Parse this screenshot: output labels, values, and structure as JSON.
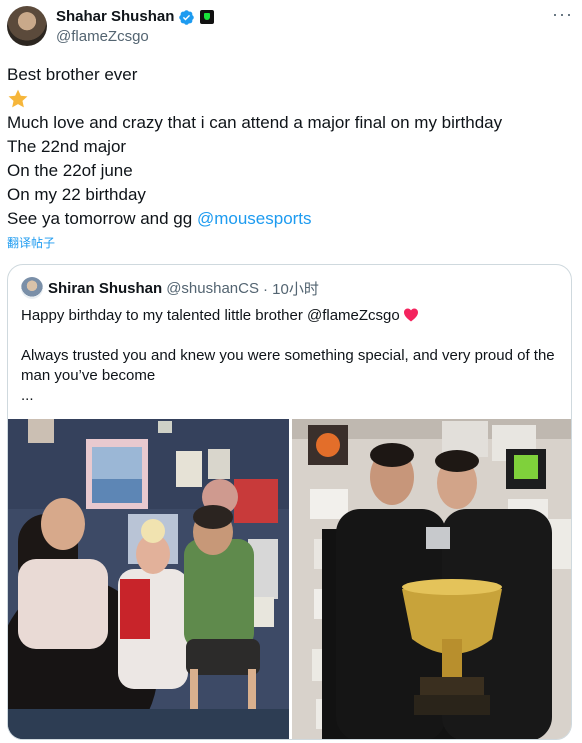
{
  "tweet": {
    "author_name": "Shahar Shushan",
    "author_handle": "@flameZcsgo",
    "more_label": "···",
    "lines": [
      "Best brother ever",
      "Much love and crazy that i can attend a major final on my birthday",
      "The 22nd major",
      "On the 22of june",
      "On my 22 birthday",
      "See ya tomorrow and gg "
    ],
    "mention": "@mousesports",
    "translate_label": "翻译帖子"
  },
  "quote": {
    "author_name": "Shiran Shushan",
    "author_handle": "@shushanCS",
    "timestamp": "· 10小时",
    "line1": "Happy birthday to my talented little brother @flameZcsgo",
    "line2": "Always trusted you and knew you were something special, and very proud of the man you’ve become",
    "ellipsis": "..."
  },
  "icons": {
    "verified": "verified-badge-icon",
    "badge": "affiliate-badge-icon",
    "star": "star-emoji-icon",
    "heart": "red-heart-emoji-icon"
  },
  "colors": {
    "accent": "#1d9bf0",
    "text": "#0f1419",
    "muted": "#536471",
    "border": "#cfd9de"
  }
}
